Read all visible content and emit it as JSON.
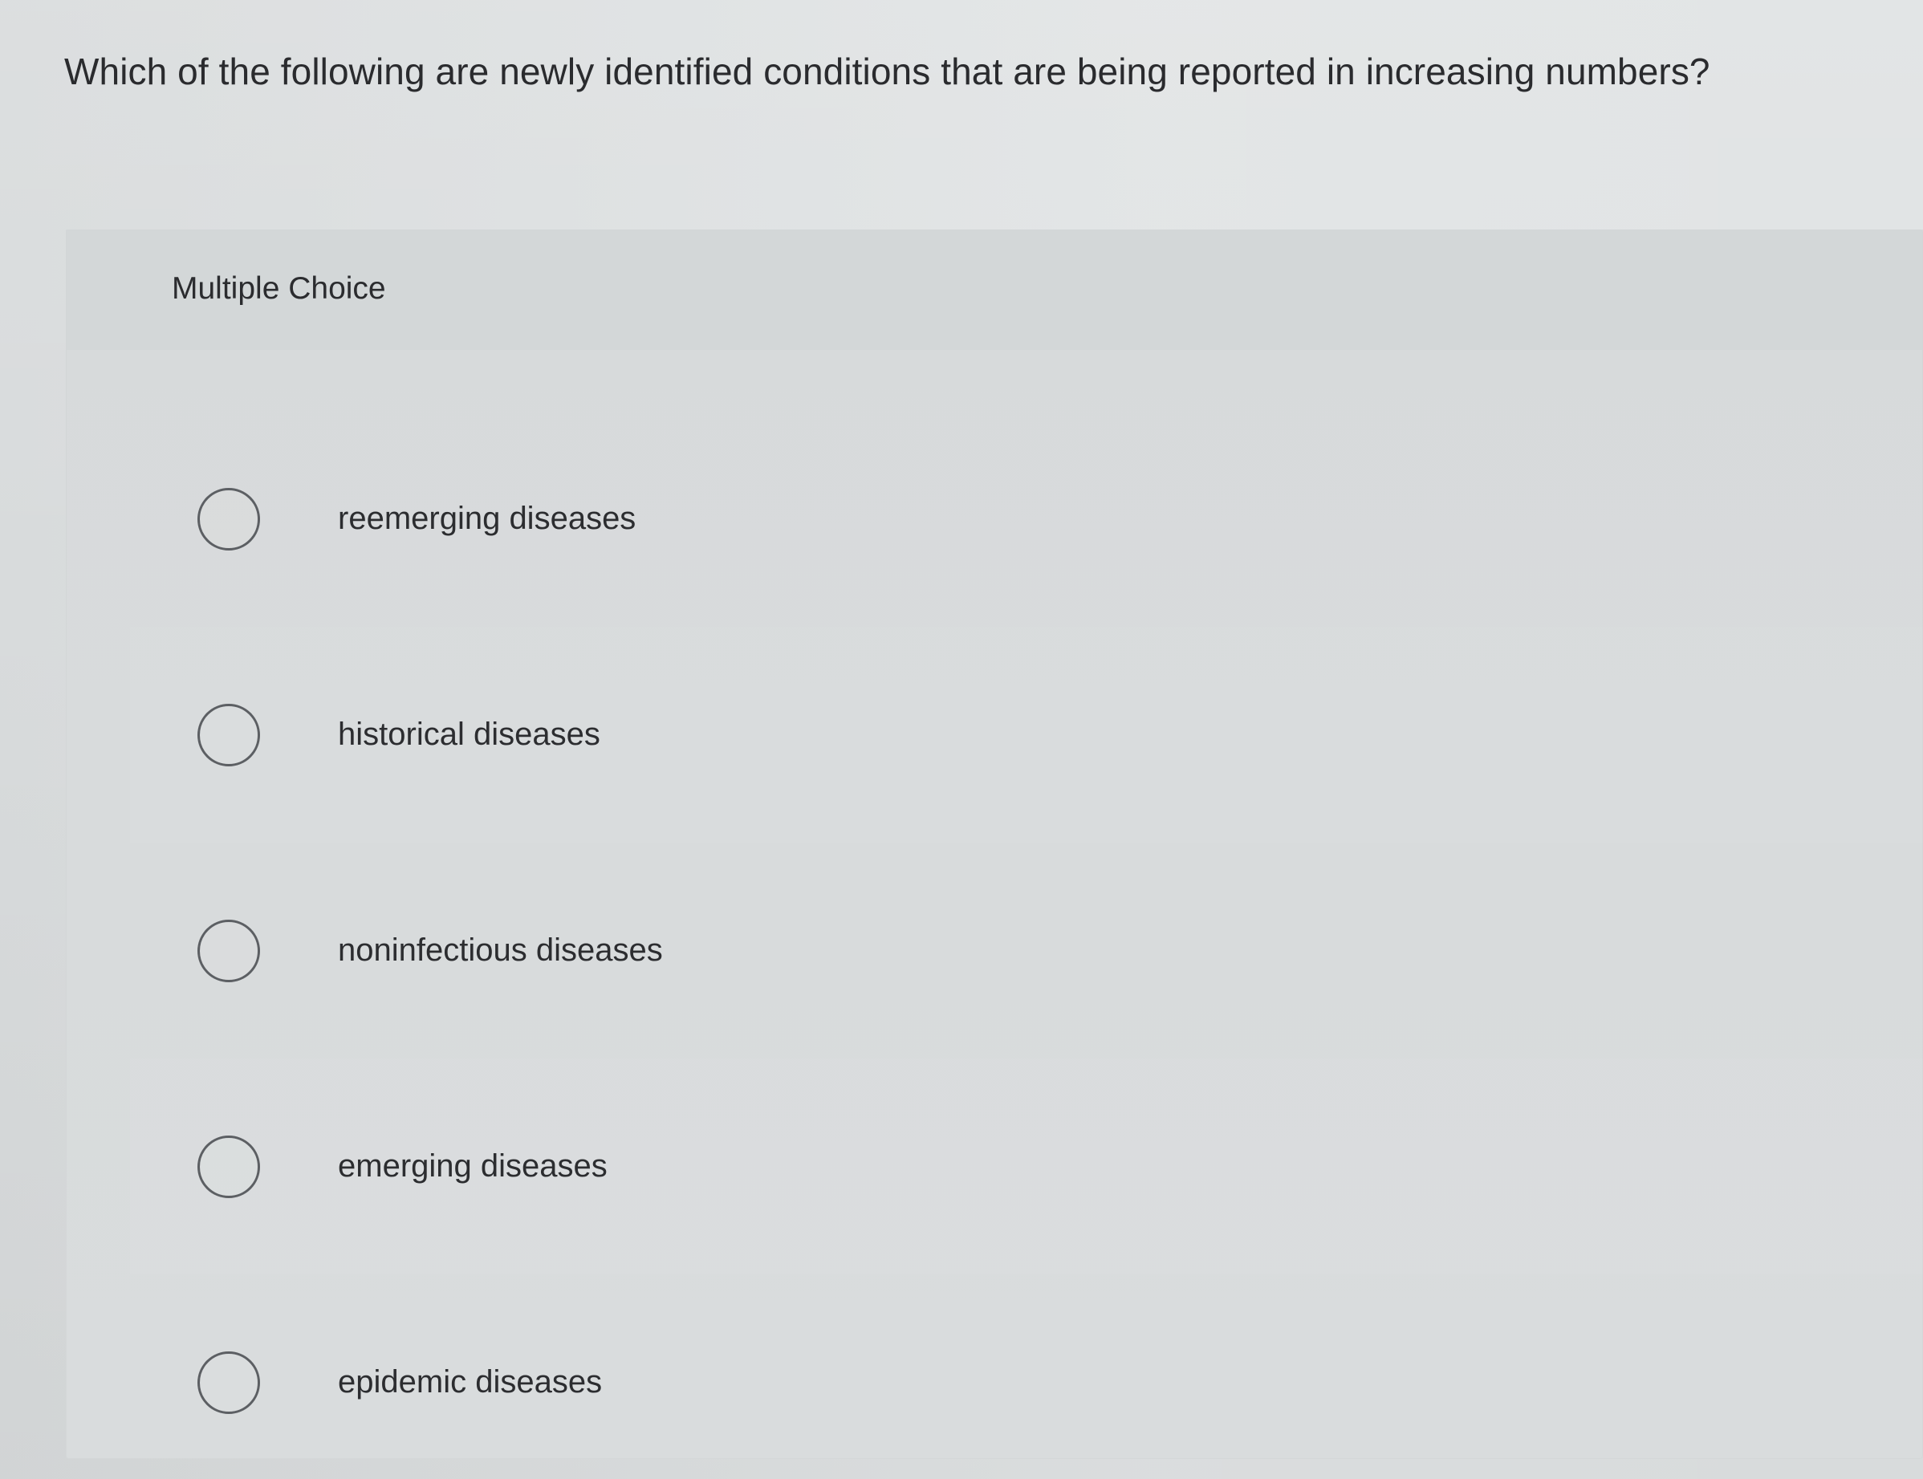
{
  "question": {
    "text": "Which of the following are newly identified conditions that are being reported in increasing numbers?"
  },
  "panel": {
    "title": "Multiple Choice",
    "options": [
      {
        "label": "reemerging diseases",
        "selected": false
      },
      {
        "label": "historical diseases",
        "selected": false
      },
      {
        "label": "noninfectious diseases",
        "selected": false
      },
      {
        "label": "emerging diseases",
        "selected": false
      },
      {
        "label": "epidemic diseases",
        "selected": false
      }
    ]
  }
}
